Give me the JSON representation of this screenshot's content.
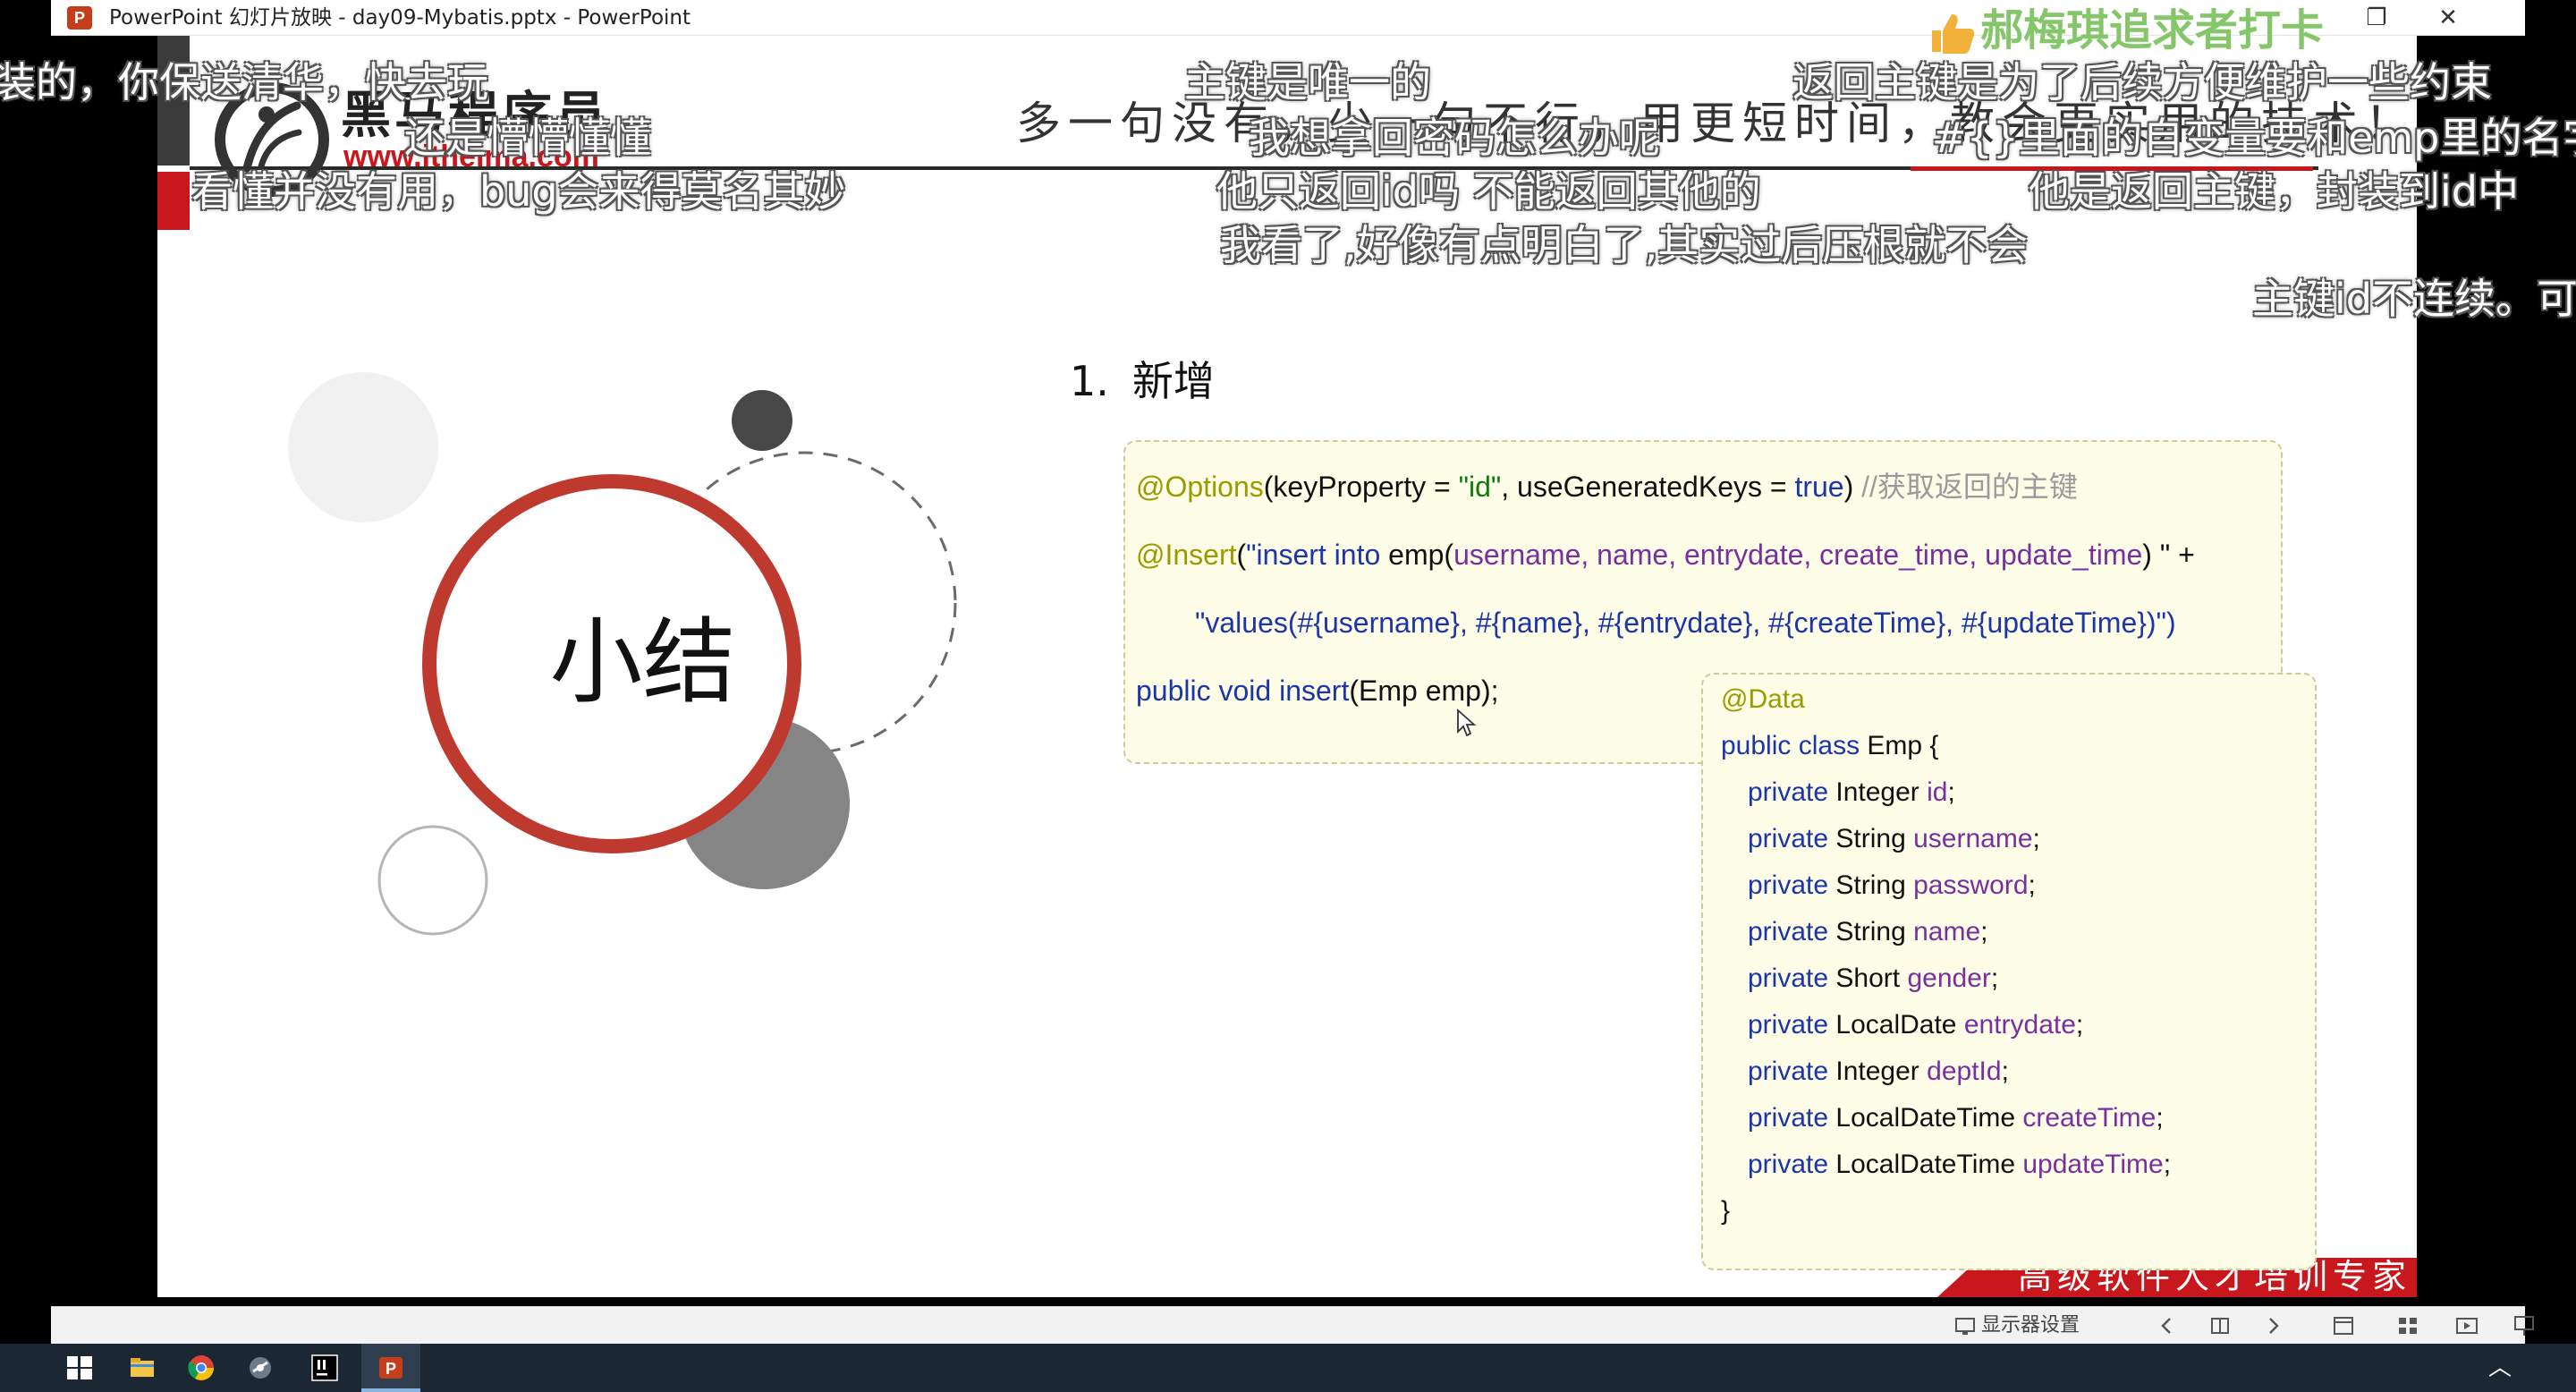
{
  "window": {
    "title": "PowerPoint 幻灯片放映  -  day09-Mybatis.pptx  -  PowerPoint",
    "app_icon": "powerpoint-icon",
    "app_icon_letter": "P",
    "controls": {
      "restore_glyph": "❐",
      "close_glyph": "✕"
    }
  },
  "slide": {
    "logo": {
      "name": "黑马程序员",
      "url": "www.itheima.com"
    },
    "header_line": "多一句没有，少一句不行，用更短时间，教会更实用的技术！",
    "summary_word": "小结",
    "section": {
      "number": "1.",
      "title": "新增"
    },
    "insert_code": {
      "options_ann": "@Options",
      "options_args_pre": "(keyProperty = ",
      "options_key_value": "\"id\"",
      "options_args_mid": ", useGeneratedKeys = ",
      "options_true": "true",
      "options_close": ") ",
      "options_comment": "//获取返回的主键",
      "insert_ann": "@Insert",
      "insert_paren": "(",
      "insert_sql_start": "\"insert into ",
      "insert_table": "emp(",
      "insert_columns": "username, name, entrydate, create_time, update_time",
      "insert_close": ") \" +",
      "values_line": "\"values(#{username}, #{name}, #{entrydate}, #{createTime}, #{updateTime})\")",
      "method_kw": "public void insert",
      "method_sig": "(Emp emp);"
    },
    "emp_code": {
      "annotation": "@Data",
      "class_kw": "public class",
      "class_name": " Emp {",
      "private_kw": "private",
      "fields": [
        {
          "type": "Integer",
          "name": "id"
        },
        {
          "type": "String",
          "name": "username"
        },
        {
          "type": "String",
          "name": "password"
        },
        {
          "type": "String",
          "name": "name"
        },
        {
          "type": "Short",
          "name": "gender"
        },
        {
          "type": "LocalDate",
          "name": "entrydate"
        },
        {
          "type": "Integer",
          "name": "deptId"
        },
        {
          "type": "LocalDateTime",
          "name": "createTime"
        },
        {
          "type": "LocalDateTime",
          "name": "updateTime"
        }
      ],
      "close": "}"
    },
    "brand_slogan": "高级软件人才培训专家"
  },
  "overlay": {
    "watermark": "郝梅琪追求者打卡",
    "comments": [
      "装的，你保送清华，快去玩",
      "主键是唯一的",
      "返回主键是为了后续方便维护一些约束",
      "还是懵懵懂懂",
      "我想拿回密码怎么办呢",
      "#{}里面的自变量要和emp里的名字",
      "看懂并没有用，bug会来得莫名其妙",
      "他只返回id吗 不能返回其他的",
      "他是返回主键，封装到id中",
      "我看了,好像有点明白了,其实过后压根就不会",
      "主键id不连续。可"
    ]
  },
  "statusbar": {
    "display_settings": "显示器设置"
  },
  "taskbar": {
    "apps": [
      "windows-start-icon",
      "file-explorer-icon",
      "chrome-icon",
      "tool-icon",
      "intellij-icon",
      "powerpoint-icon"
    ],
    "tray_glyph": "︿"
  },
  "colors": {
    "brand_red": "#c9171e",
    "code_bg": "#fdfde8",
    "annotation": "#9b9b00",
    "keyword": "#1c35a8",
    "string": "#0d7a0d",
    "field": "#7a2fa0",
    "watermark_green": "#86c66b",
    "taskbar_bg": "#1b2733"
  }
}
